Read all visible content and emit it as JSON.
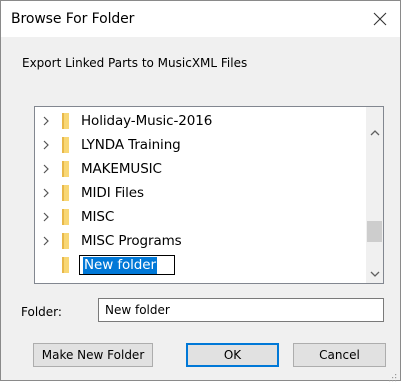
{
  "window": {
    "title": "Browse For Folder"
  },
  "description": "Export Linked Parts to MusicXML Files",
  "tree": {
    "items": [
      {
        "label": "Holiday-Music-2016",
        "expandable": true
      },
      {
        "label": "LYNDA Training",
        "expandable": true
      },
      {
        "label": "MAKEMUSIC",
        "expandable": true
      },
      {
        "label": "MIDI Files",
        "expandable": true
      },
      {
        "label": "MISC",
        "expandable": true
      },
      {
        "label": "MISC Programs",
        "expandable": true
      }
    ],
    "editing_item": {
      "label": "New folder"
    }
  },
  "folder_field": {
    "label": "Folder:",
    "value": "New folder"
  },
  "buttons": {
    "make_new_folder": "Make New Folder",
    "ok": "OK",
    "cancel": "Cancel"
  },
  "icons": {
    "close": "close-icon",
    "expand": "chevron-right-icon",
    "folder": "folder-icon",
    "scroll_up": "chevron-up-icon",
    "scroll_down": "chevron-down-icon",
    "resize": "resize-grip-icon"
  },
  "colors": {
    "selection": "#0078d7",
    "folder": "#f8d775",
    "dialog_bg": "#f0f0f0"
  }
}
